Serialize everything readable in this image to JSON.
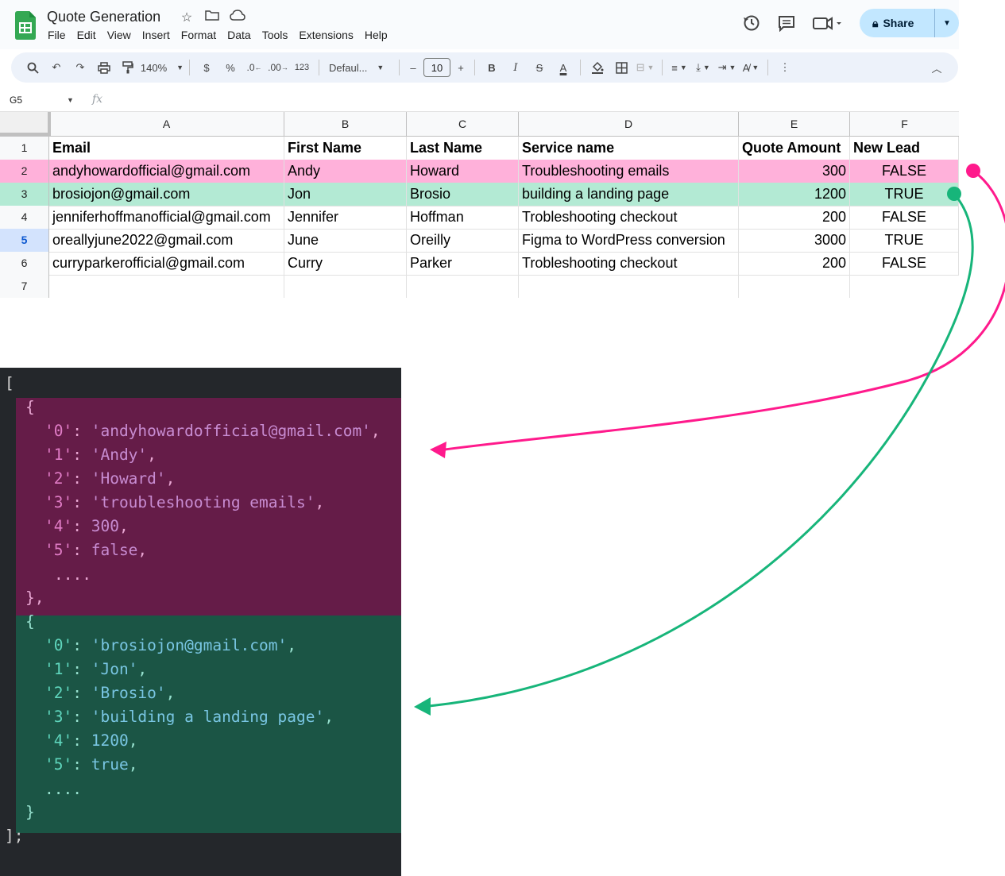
{
  "app": {
    "title": "Quote Generation",
    "menu": [
      "File",
      "Edit",
      "View",
      "Insert",
      "Format",
      "Data",
      "Tools",
      "Extensions",
      "Help"
    ],
    "share_label": "Share"
  },
  "toolbar": {
    "zoom": "140%",
    "currency": "$",
    "percent": "%",
    "dec_decrease": ".0",
    "dec_increase": ".00",
    "number_format": "123",
    "font": "Defaul...",
    "font_size": "10"
  },
  "formula_bar": {
    "cell_ref": "G5",
    "fx": "fx"
  },
  "sheet": {
    "columns": [
      "A",
      "B",
      "C",
      "D",
      "E",
      "F"
    ],
    "row_numbers": [
      "1",
      "2",
      "3",
      "4",
      "5",
      "6",
      "7"
    ],
    "headers": [
      "Email",
      "First Name",
      "Last Name",
      "Service name",
      "Quote Amount",
      "New Lead"
    ],
    "rows": [
      [
        "andyhowardofficial@gmail.com",
        "Andy",
        "Howard",
        "Troubleshooting emails",
        "300",
        "FALSE"
      ],
      [
        "brosiojon@gmail.com",
        "Jon",
        "Brosio",
        "building a landing page",
        "1200",
        "TRUE"
      ],
      [
        "jenniferhoffmanofficial@gmail.com",
        "Jennifer",
        "Hoffman",
        "Trobleshooting checkout",
        "200",
        "FALSE"
      ],
      [
        "oreallyjune2022@gmail.com",
        "June",
        "Oreilly",
        "Figma to WordPress conversion",
        "3000",
        "TRUE"
      ],
      [
        "curryparkerofficial@gmail.com",
        "Curry",
        "Parker",
        "Trobleshooting checkout",
        "200",
        "FALSE"
      ]
    ]
  },
  "code": {
    "open": "[",
    "close": "];",
    "brace_open": "{",
    "brace_close_comma": "},",
    "brace_close": "}",
    "ellipsis": "....",
    "obj1": [
      {
        "k": "'0'",
        "v": "'andyhowardofficial@gmail.com'"
      },
      {
        "k": "'1'",
        "v": "'Andy'"
      },
      {
        "k": "'2'",
        "v": "'Howard'"
      },
      {
        "k": "'3'",
        "v": "'troubleshooting emails'"
      },
      {
        "k": "'4'",
        "v": "300"
      },
      {
        "k": "'5'",
        "v": "false"
      }
    ],
    "obj2": [
      {
        "k": "'0'",
        "v": "'brosiojon@gmail.com'"
      },
      {
        "k": "'1'",
        "v": "'Jon'"
      },
      {
        "k": "'2'",
        "v": "'Brosio'"
      },
      {
        "k": "'3'",
        "v": "'building a landing page'"
      },
      {
        "k": "'4'",
        "v": "1200"
      },
      {
        "k": "'5'",
        "v": "true"
      }
    ]
  },
  "colors": {
    "pink_row": "#ffb1da",
    "green_row": "#b3ead4",
    "pink_arrow": "#ff1a8c",
    "green_arrow": "#17b57a",
    "code_bg": "#24272b",
    "pink_block": "#651c48",
    "green_block": "#1b5545"
  }
}
